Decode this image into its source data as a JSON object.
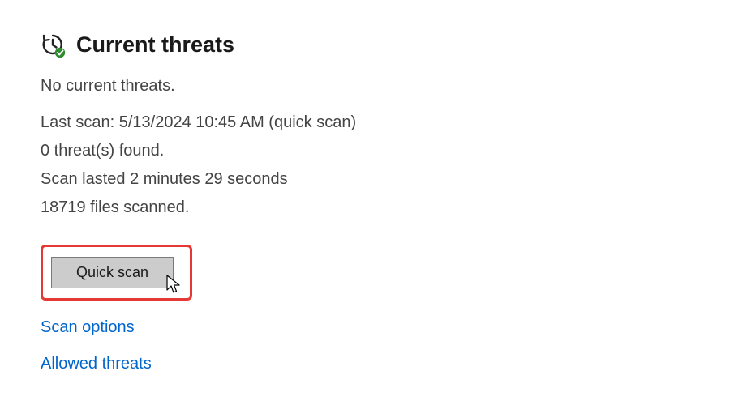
{
  "header": {
    "title": "Current threats"
  },
  "status": {
    "no_threats": "No current threats."
  },
  "scan_info": {
    "last_scan": "Last scan: 5/13/2024 10:45 AM (quick scan)",
    "threats_found": "0 threat(s) found.",
    "scan_duration": "Scan lasted 2 minutes 29 seconds",
    "files_scanned": "18719 files scanned."
  },
  "buttons": {
    "quick_scan": "Quick scan"
  },
  "links": {
    "scan_options": "Scan options",
    "allowed_threats": "Allowed threats"
  }
}
